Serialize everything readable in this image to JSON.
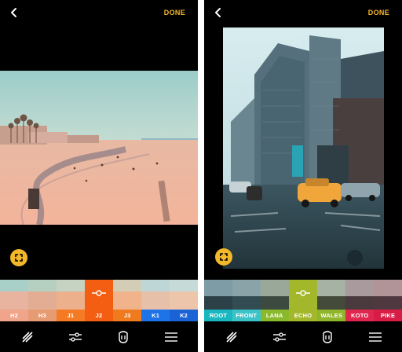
{
  "left_screen": {
    "done_label": "DONE",
    "filters": [
      {
        "label": "H2",
        "color": "#f0a48a"
      },
      {
        "label": "H3",
        "color": "#e79b73"
      },
      {
        "label": "J1",
        "color": "#f47a24"
      },
      {
        "label": "J2",
        "color": "#f45e12",
        "active": true
      },
      {
        "label": "J3",
        "color": "#f07a1e"
      },
      {
        "label": "K1",
        "color": "#1f73e8"
      },
      {
        "label": "K2",
        "color": "#1a63d6"
      }
    ],
    "accent": "#f3b82a"
  },
  "right_screen": {
    "done_label": "DONE",
    "filters": [
      {
        "label": "ROOT",
        "color": "#19b8c0"
      },
      {
        "label": "FRONT",
        "color": "#3cc3c8"
      },
      {
        "label": "LANA",
        "color": "#8ab92c"
      },
      {
        "label": "ECHO",
        "color": "#a3b72a",
        "active": true
      },
      {
        "label": "WALES",
        "color": "#8fb52a"
      },
      {
        "label": "KOTO",
        "color": "#e0264e"
      },
      {
        "label": "PIKE",
        "color": "#d81c46"
      }
    ],
    "accent": "#f3b82a"
  },
  "toolbar_icons": [
    "filters-icon",
    "adjust-icon",
    "mask-icon",
    "text-icon"
  ]
}
